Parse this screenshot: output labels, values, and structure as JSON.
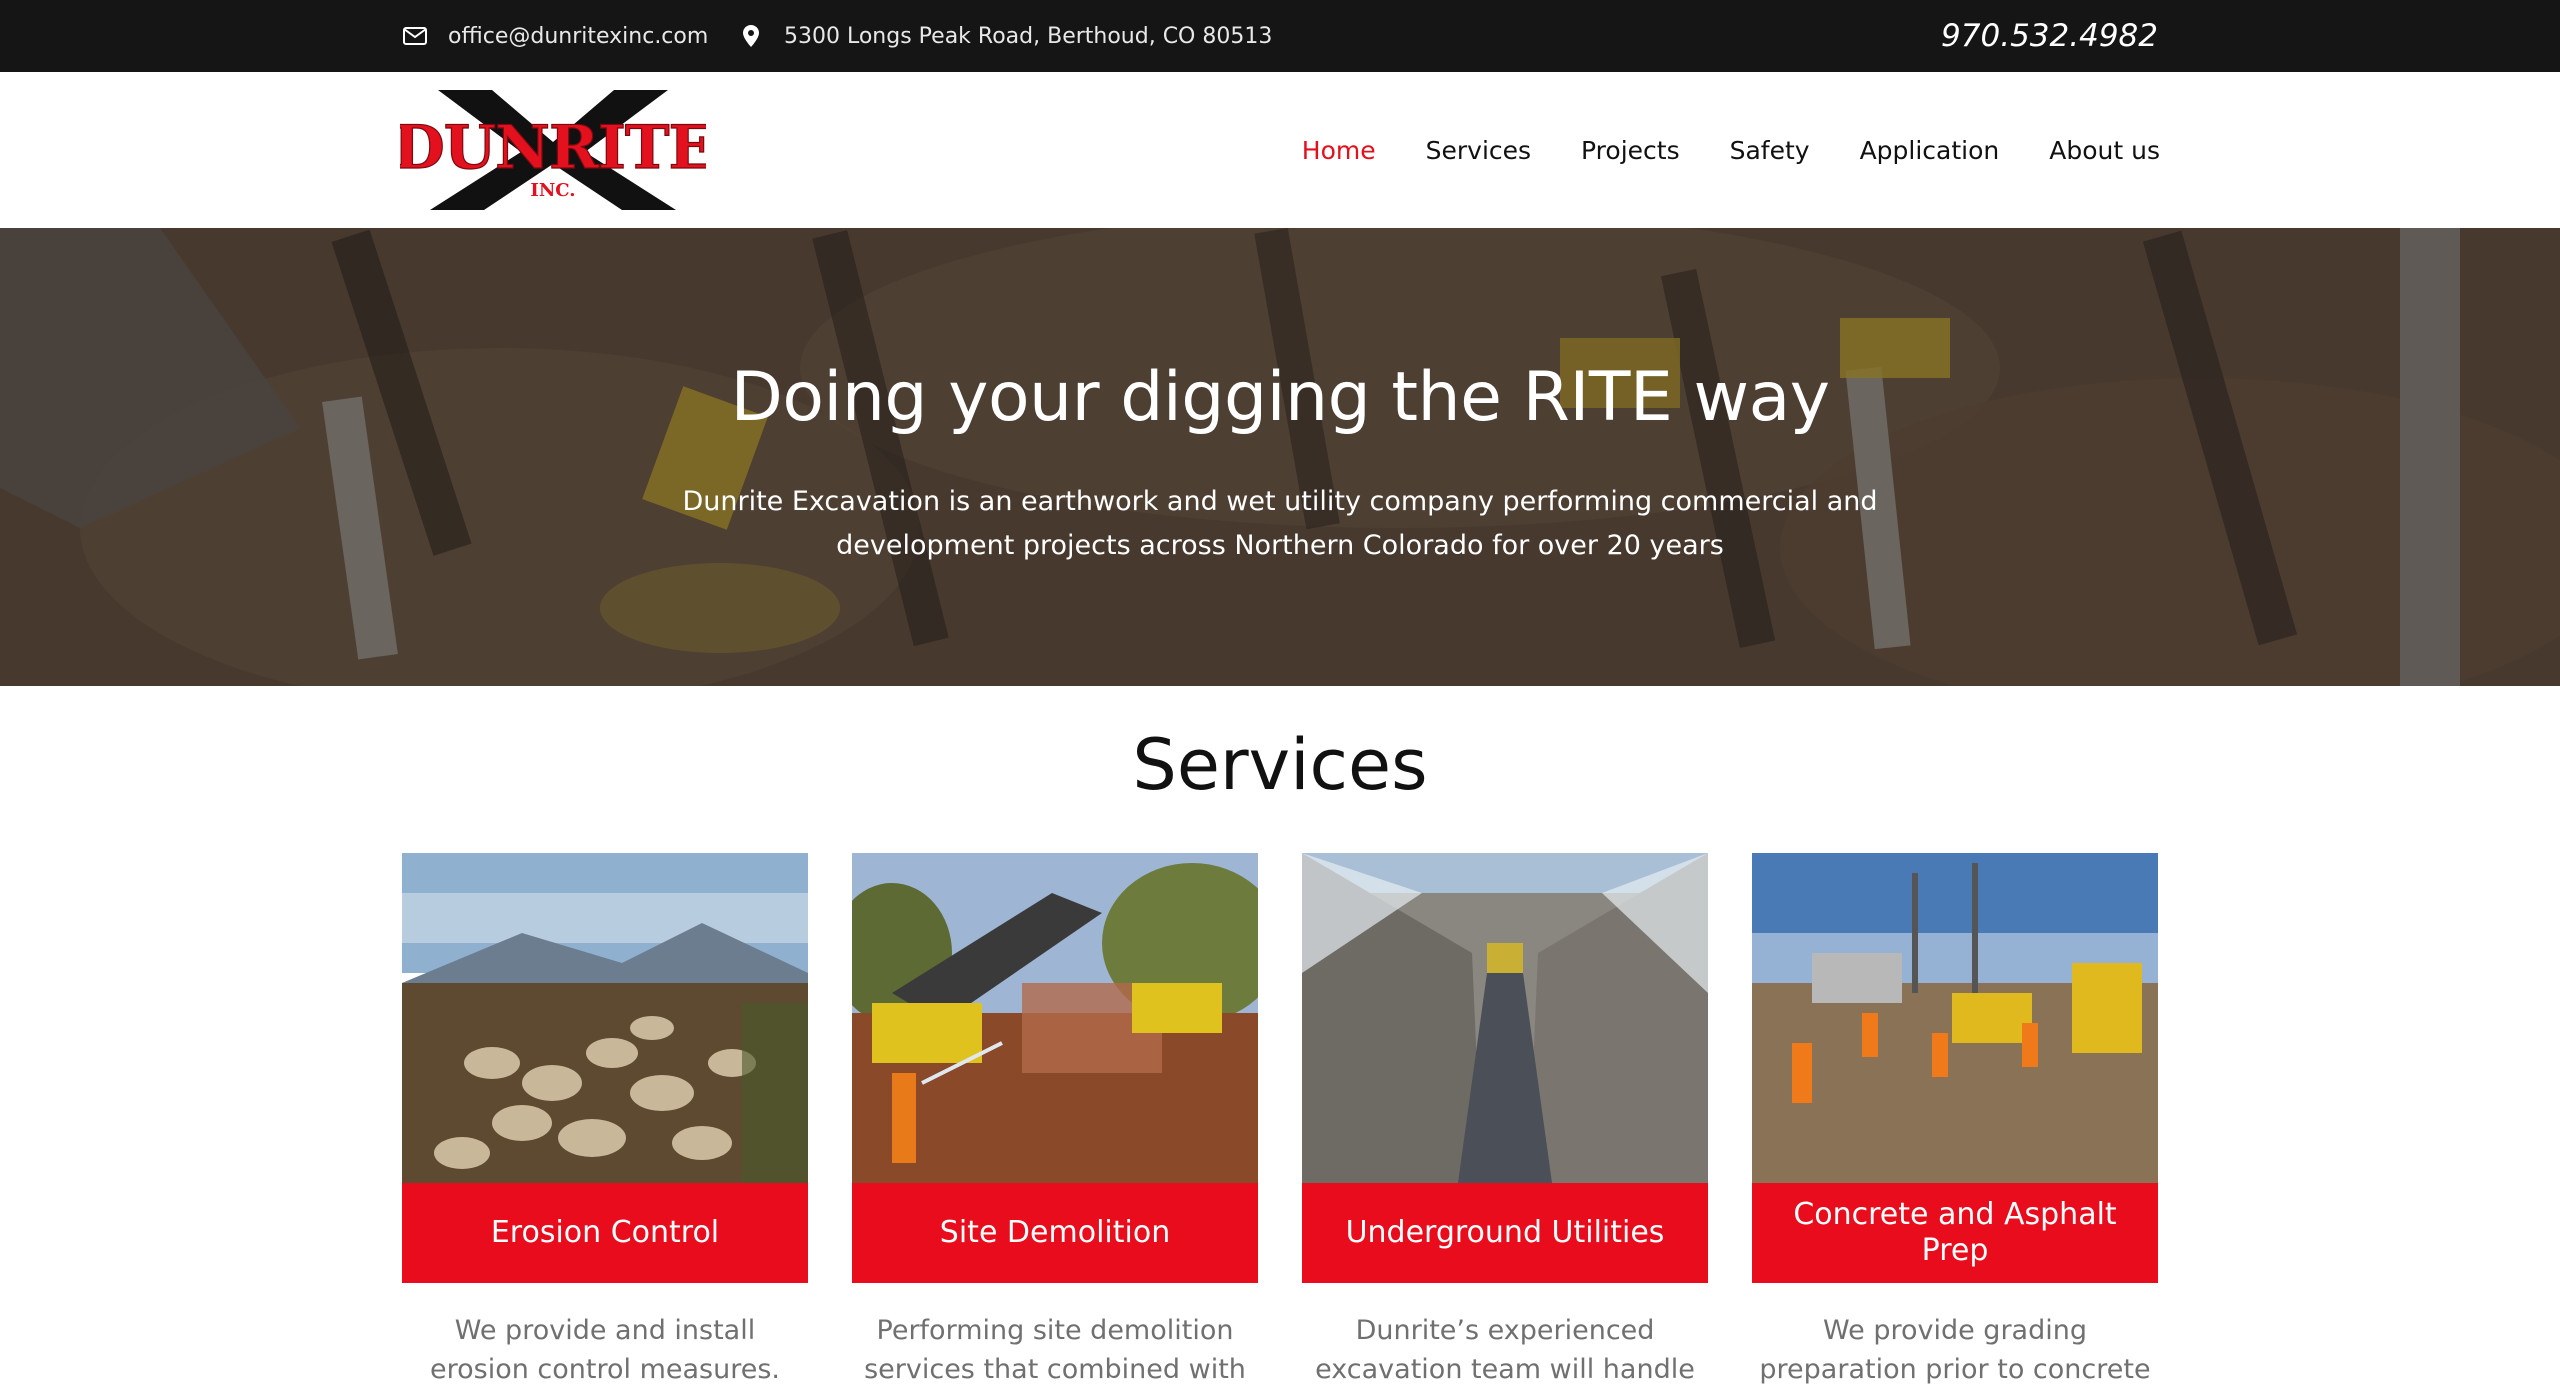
{
  "topbar": {
    "email": "office@dunritexinc.com",
    "address": "5300 Longs Peak Road, Berthoud, CO 80513",
    "phone": "970.532.4982",
    "email_icon": "envelope-icon",
    "address_icon": "map-pin-icon"
  },
  "logo": {
    "main": "DUNRITE",
    "sub": "INC.",
    "mark": "X"
  },
  "nav": {
    "items": [
      {
        "label": "Home",
        "active": true
      },
      {
        "label": "Services",
        "active": false
      },
      {
        "label": "Projects",
        "active": false
      },
      {
        "label": "Safety",
        "active": false
      },
      {
        "label": "Application",
        "active": false
      },
      {
        "label": "About us",
        "active": false
      }
    ]
  },
  "hero": {
    "title": "Doing your digging the RITE way",
    "subtitle": "Dunrite Excavation is an earthwork and wet utility company performing commercial and development projects across Northern Colorado for over 20 years"
  },
  "services": {
    "title": "Services",
    "cards": [
      {
        "label": "Erosion Control",
        "desc": "We provide and install erosion control measures."
      },
      {
        "label": "Site Demolition",
        "desc": "Performing site demolition services that combined with"
      },
      {
        "label": "Underground Utilities",
        "desc": "Dunrite’s experienced excavation team will handle all"
      },
      {
        "label": "Concrete and Asphalt Prep",
        "desc": "We provide grading preparation prior to concrete"
      }
    ]
  },
  "colors": {
    "accent": "#e80c1d",
    "topbar": "#151515",
    "nav_active": "#e3101d"
  }
}
